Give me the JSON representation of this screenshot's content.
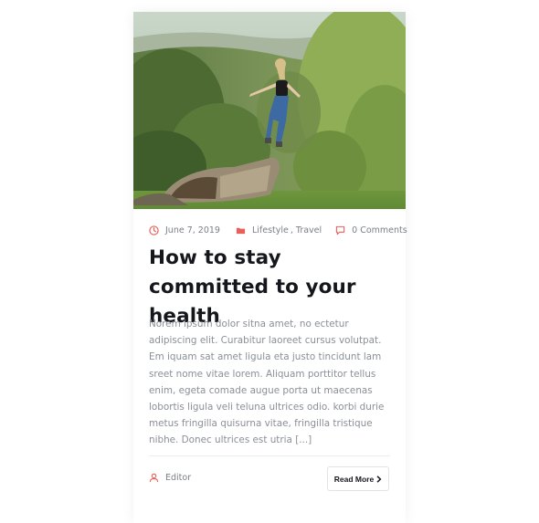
{
  "post": {
    "image_alt": "Woman leaping off a fallen log in a green meadow",
    "date": "June 7, 2019",
    "categories": [
      "Lifestyle",
      "Travel"
    ],
    "category_separator": ",",
    "comments": "0 Comments",
    "title": "How to stay committed to your health",
    "excerpt": "Norem ipsum dolor sitna amet, no ectetur adipiscing elit. Curabitur laoreet cursus volutpat. Em iquam sat amet ligula eta justo tincidunt lam sreet nome vitae lorem. Aliquam porttitor tellus enim, egeta comade augue porta ut maecenas lobortis ligula veli teluna ultrices odio. korbi durie metus fringilla quisurna vitae, fringilla tristique nibhe. Donec ultrices est utria [...]",
    "author": "Editor",
    "read_more": "Read More"
  },
  "icons": {
    "date": "clock-icon",
    "category": "folder-icon",
    "comments": "comment-icon",
    "author": "user-icon",
    "read_more": "chevron-right-icon"
  },
  "colors": {
    "accent": "#e9605a",
    "title": "#15171c",
    "muted_text": "#8a8f97"
  }
}
